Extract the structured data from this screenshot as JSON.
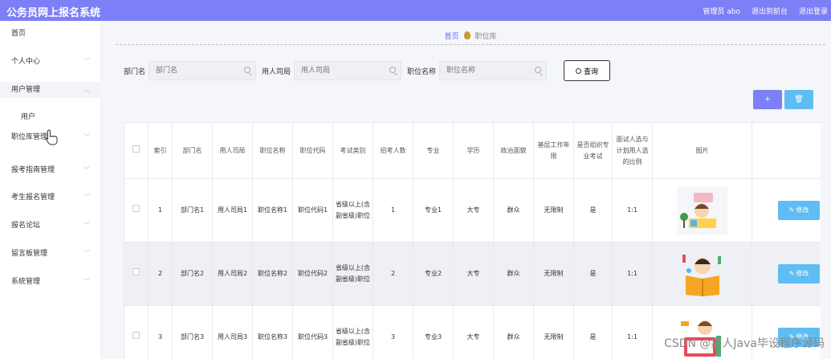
{
  "topbar": {
    "title": "公务员网上报名系统",
    "admin": "管理员 abo",
    "back": "退出到前台",
    "logout": "退出登录"
  },
  "sidebar": {
    "items": [
      {
        "label": "首页"
      },
      {
        "label": "个人中心"
      },
      {
        "label": "用户管理"
      },
      {
        "label": "职位库管理"
      },
      {
        "label": "报考指南管理"
      },
      {
        "label": "考生报名管理"
      },
      {
        "label": "报名论坛"
      },
      {
        "label": "留言板管理"
      },
      {
        "label": "系统管理"
      }
    ],
    "sub_user": "用户"
  },
  "breadcrumb": {
    "home": "首页",
    "current": "职位库"
  },
  "search": {
    "dept_label": "部门名",
    "dept_placeholder": "部门名",
    "bureau_label": "用人司局",
    "bureau_placeholder": "用人司局",
    "position_label": "职位名称",
    "position_placeholder": "职位名称",
    "query_label": "查询"
  },
  "actions": {
    "add": "+",
    "delete": "🗑"
  },
  "table": {
    "headers": [
      "索引",
      "部门名",
      "用人司局",
      "职位名称",
      "职位代码",
      "考试类别",
      "招考人数",
      "专业",
      "学历",
      "政治面貌",
      "基层工作年限",
      "是否组织专业考试",
      "面试人选与计划用人选的比例",
      "图片"
    ],
    "rows": [
      {
        "index": "1",
        "dept": "部门名1",
        "bureau": "用人司局1",
        "position": "职位名称1",
        "code": "职位代码1",
        "exam_type": "省级以上(含副省级)职位",
        "count": "1",
        "major": "专业1",
        "edu": "大专",
        "politics": "群众",
        "years": "无限制",
        "pro_exam": "是",
        "ratio": "1:1",
        "edit": "修改"
      },
      {
        "index": "2",
        "dept": "部门名2",
        "bureau": "用人司局2",
        "position": "职位名称2",
        "code": "职位代码2",
        "exam_type": "省级以上(含副省级)职位",
        "count": "2",
        "major": "专业2",
        "edu": "大专",
        "politics": "群众",
        "years": "无限制",
        "pro_exam": "是",
        "ratio": "1:1",
        "edit": "修改"
      },
      {
        "index": "3",
        "dept": "部门名3",
        "bureau": "用人司局3",
        "position": "职位名称3",
        "code": "职位代码3",
        "exam_type": "省级以上(含副省级)职位",
        "count": "3",
        "major": "专业3",
        "edu": "大专",
        "politics": "群众",
        "years": "无限制",
        "pro_exam": "是",
        "ratio": "1:1",
        "edit": "修改"
      }
    ]
  },
  "watermark": "CSDN @嘉人Java毕设程序源码",
  "colors": {
    "primary": "#7c7ff5",
    "edit": "#5ebdf3",
    "link": "#5b6ef5"
  }
}
